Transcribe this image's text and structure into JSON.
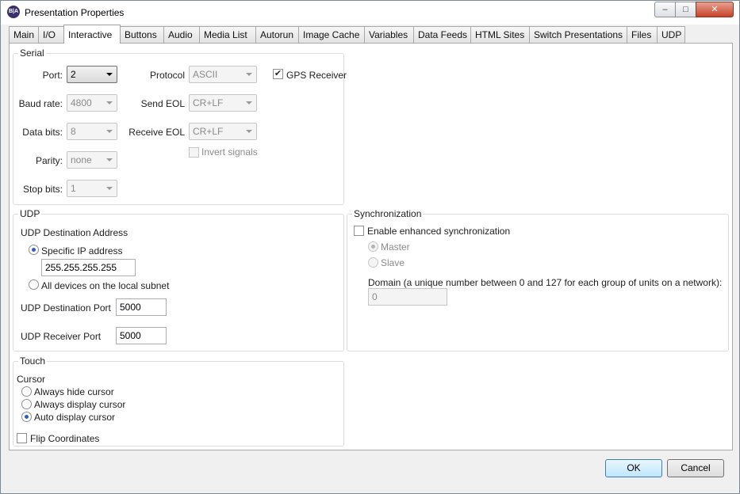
{
  "window": {
    "title": "Presentation Properties",
    "app_icon_text": "B|A",
    "min_glyph": "–",
    "max_glyph": "□",
    "close_glyph": "✕"
  },
  "tabs": [
    {
      "label": "Main"
    },
    {
      "label": "I/O"
    },
    {
      "label": "Interactive",
      "active": true
    },
    {
      "label": "Buttons"
    },
    {
      "label": "Audio"
    },
    {
      "label": "Media List"
    },
    {
      "label": "Autorun"
    },
    {
      "label": "Image Cache"
    },
    {
      "label": "Variables"
    },
    {
      "label": "Data Feeds"
    },
    {
      "label": "HTML Sites"
    },
    {
      "label": "Switch Presentations"
    },
    {
      "label": "Files"
    },
    {
      "label": "UDP"
    }
  ],
  "serial": {
    "title": "Serial",
    "port_label": "Port:",
    "port_value": "2",
    "baud_label": "Baud rate:",
    "baud_value": "4800",
    "databits_label": "Data bits:",
    "databits_value": "8",
    "parity_label": "Parity:",
    "parity_value": "none",
    "stopbits_label": "Stop bits:",
    "stopbits_value": "1",
    "protocol_label": "Protocol",
    "protocol_value": "ASCII",
    "send_eol_label": "Send EOL",
    "send_eol_value": "CR+LF",
    "receive_eol_label": "Receive EOL",
    "receive_eol_value": "CR+LF",
    "invert_label": "Invert signals",
    "gps_label": "GPS Receiver",
    "gps_checked": true,
    "check_glyph": "✔"
  },
  "udp": {
    "title": "UDP",
    "dest_address_label": "UDP Destination Address",
    "specific_ip_label": "Specific IP address",
    "ip_value": "255.255.255.255",
    "all_devices_label": "All devices on the local subnet",
    "dest_port_label": "UDP Destination Port",
    "dest_port_value": "5000",
    "receiver_port_label": "UDP Receiver Port",
    "receiver_port_value": "5000"
  },
  "sync": {
    "title": "Synchronization",
    "enable_label": "Enable enhanced synchronization",
    "master_label": "Master",
    "slave_label": "Slave",
    "domain_label": "Domain (a unique number between 0 and 127 for each group of units on a network):",
    "domain_value": "0"
  },
  "touch": {
    "title": "Touch",
    "cursor_label": "Cursor",
    "hide_label": "Always hide cursor",
    "display_label": "Always display cursor",
    "auto_label": "Auto display cursor",
    "flip_label": "Flip Coordinates"
  },
  "buttons": {
    "ok": "OK",
    "cancel": "Cancel"
  }
}
